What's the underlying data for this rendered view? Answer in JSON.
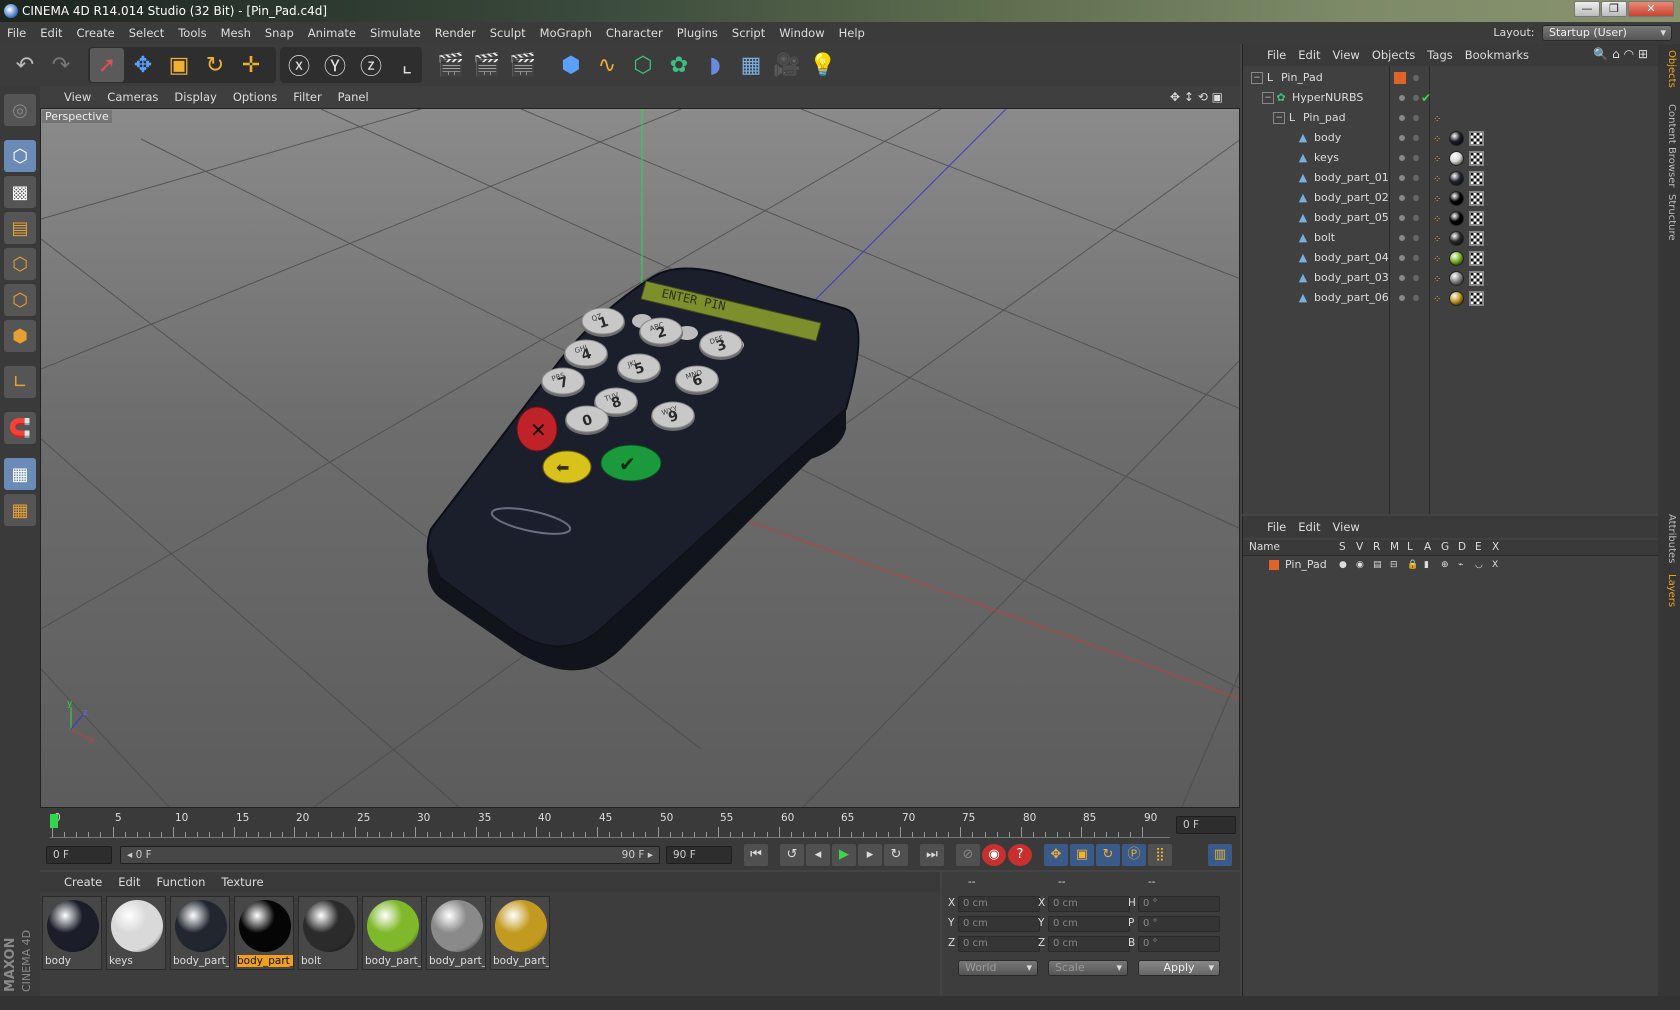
{
  "window": {
    "title": "CINEMA 4D R14.014 Studio (32 Bit) - [Pin_Pad.c4d]",
    "minimize": "—",
    "restore": "❐",
    "close": "✕"
  },
  "menu": [
    "File",
    "Edit",
    "Create",
    "Select",
    "Tools",
    "Mesh",
    "Snap",
    "Animate",
    "Simulate",
    "Render",
    "Sculpt",
    "MoGraph",
    "Character",
    "Plugins",
    "Script",
    "Window",
    "Help"
  ],
  "layout": {
    "label": "Layout:",
    "value": "Startup (User)"
  },
  "viewport": {
    "menu": [
      "View",
      "Cameras",
      "Display",
      "Options",
      "Filter",
      "Panel"
    ],
    "label": "Perspective",
    "device_screen_text": "ENTER PIN",
    "keys": [
      {
        "main": "1",
        "sub": "QZ"
      },
      {
        "main": "2",
        "sub": "ABC"
      },
      {
        "main": "3",
        "sub": "DEF"
      },
      {
        "main": "4",
        "sub": "GHI"
      },
      {
        "main": "5",
        "sub": "JKL"
      },
      {
        "main": "6",
        "sub": "MNO"
      },
      {
        "main": "7",
        "sub": "PRS"
      },
      {
        "main": "8",
        "sub": "TUV"
      },
      {
        "main": "9",
        "sub": "WXY"
      },
      {
        "main": "0",
        "sub": ""
      }
    ],
    "cancel_glyph": "✕",
    "back_glyph": "⬅",
    "ok_glyph": "✔",
    "axis": {
      "x": "x",
      "y": "y",
      "z": "z"
    }
  },
  "timeline": {
    "ticks": [
      "0",
      "5",
      "10",
      "15",
      "20",
      "25",
      "30",
      "35",
      "40",
      "45",
      "50",
      "55",
      "60",
      "65",
      "70",
      "75",
      "80",
      "85",
      "90"
    ],
    "current_frame": "0 F",
    "start": "0 F",
    "range_left": "◂ 0 F",
    "range_right": "90 F ▸",
    "end": "90 F"
  },
  "materials": {
    "menu": [
      "Create",
      "Edit",
      "Function",
      "Texture"
    ],
    "items": [
      {
        "name": "body",
        "color": "#1b1e28",
        "selected": false
      },
      {
        "name": "keys",
        "color": "#d9d9d9",
        "selected": false
      },
      {
        "name": "body_part_",
        "color": "#22262f",
        "selected": false
      },
      {
        "name": "body_part_",
        "color": "#050505",
        "selected": true
      },
      {
        "name": "bolt",
        "color": "#2b2b2b",
        "selected": false
      },
      {
        "name": "body_part_",
        "color": "#7fb82a",
        "selected": false
      },
      {
        "name": "body_part_",
        "color": "#8a8a8a",
        "selected": false
      },
      {
        "name": "body_part_",
        "color": "#c39a20",
        "selected": false
      }
    ]
  },
  "brand": {
    "maxon": "MAXON",
    "cinema": "CINEMA 4D"
  },
  "coords": {
    "headers": [
      "--",
      "--",
      "--"
    ],
    "rows": [
      {
        "a": "X",
        "av": "0 cm",
        "b": "X",
        "bv": "0 cm",
        "c": "H",
        "cv": "0 °"
      },
      {
        "a": "Y",
        "av": "0 cm",
        "b": "Y",
        "bv": "0 cm",
        "c": "P",
        "cv": "0 °"
      },
      {
        "a": "Z",
        "av": "0 cm",
        "b": "Z",
        "bv": "0 cm",
        "c": "B",
        "cv": "0 °"
      }
    ],
    "world": "World",
    "scale": "Scale",
    "apply": "Apply"
  },
  "objects": {
    "menu": [
      "File",
      "Edit",
      "View",
      "Objects",
      "Tags",
      "Bookmarks"
    ],
    "tree": [
      {
        "name": "Pin_Pad",
        "indent": 0,
        "tags": false
      },
      {
        "name": "HyperNURBS",
        "indent": 1,
        "tags": false
      },
      {
        "name": "Pin_pad",
        "indent": 2,
        "tags": false
      },
      {
        "name": "body",
        "indent": 3,
        "tags": true,
        "mat": "#1b1e28"
      },
      {
        "name": "keys",
        "indent": 3,
        "tags": true,
        "mat": "#d9d9d9"
      },
      {
        "name": "body_part_01",
        "indent": 3,
        "tags": true,
        "mat": "#22262f"
      },
      {
        "name": "body_part_02",
        "indent": 3,
        "tags": true,
        "mat": "#050505"
      },
      {
        "name": "body_part_05",
        "indent": 3,
        "tags": true,
        "mat": "#050505"
      },
      {
        "name": "bolt",
        "indent": 3,
        "tags": true,
        "mat": "#2b2b2b"
      },
      {
        "name": "body_part_04",
        "indent": 3,
        "tags": true,
        "mat": "#7fb82a"
      },
      {
        "name": "body_part_03",
        "indent": 3,
        "tags": true,
        "mat": "#8a8a8a"
      },
      {
        "name": "body_part_06",
        "indent": 3,
        "tags": true,
        "mat": "#c39a20"
      }
    ]
  },
  "layers": {
    "menu": [
      "File",
      "Edit",
      "View"
    ],
    "columns": [
      "Name",
      "S",
      "V",
      "R",
      "M",
      "L",
      "A",
      "G",
      "D",
      "E",
      "X"
    ],
    "rows": [
      {
        "name": "Pin_Pad",
        "color": "#e0642a"
      }
    ]
  },
  "right_tabs": [
    "Objects",
    "Content Browser",
    "Structure",
    "Attributes",
    "Layers"
  ]
}
